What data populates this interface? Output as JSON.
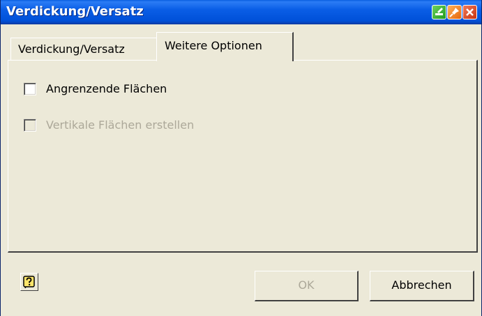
{
  "window": {
    "title": "Verdickung/Versatz"
  },
  "titlebar_buttons": [
    {
      "icon": "green-pen-icon",
      "color": "#2fb52f"
    },
    {
      "icon": "orange-pin-icon",
      "color": "#f08a24"
    },
    {
      "icon": "close-icon",
      "color": "#d8441a"
    }
  ],
  "tabs": [
    {
      "label": "Verdickung/Versatz",
      "active": false
    },
    {
      "label": "Weitere Optionen",
      "active": true
    }
  ],
  "options": [
    {
      "label": "Angrenzende Flächen",
      "checked": false,
      "enabled": true
    },
    {
      "label": "Vertikale Flächen erstellen",
      "checked": false,
      "enabled": false
    }
  ],
  "footer": {
    "help_icon": "help-question-icon",
    "ok_label": "OK",
    "ok_enabled": false,
    "cancel_label": "Abbrechen"
  },
  "colors": {
    "titlebar": "#0a5ee6",
    "dialog_bg": "#ece9d8",
    "disabled_text": "#aca899"
  }
}
